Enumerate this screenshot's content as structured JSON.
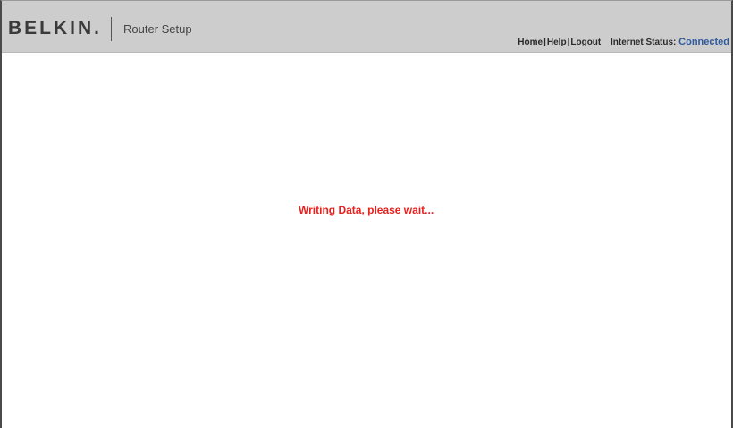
{
  "header": {
    "brand": "BELKIN.",
    "app_title": "Router Setup",
    "nav": {
      "home": "Home",
      "help": "Help",
      "logout": "Logout",
      "separator": "|"
    },
    "internet_status": {
      "label": "Internet Status:",
      "value": "Connected",
      "value_color": "#2f5a9e"
    }
  },
  "main": {
    "status_message": "Writing Data, please wait...",
    "status_message_color": "#e8201e"
  }
}
